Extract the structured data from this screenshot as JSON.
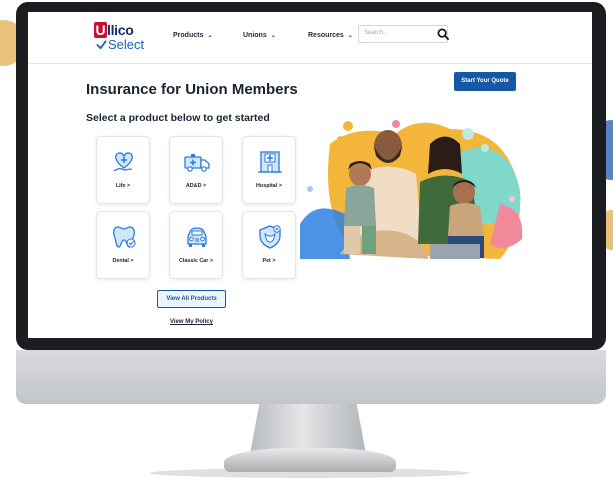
{
  "brand": {
    "logo_mark": "U",
    "logo_top": "llico",
    "logo_bottom": "Select"
  },
  "nav": {
    "items": [
      {
        "label": "Products",
        "icon": "chevron-down-icon"
      },
      {
        "label": "Unions",
        "icon": "chevron-down-icon"
      },
      {
        "label": "Resources",
        "icon": "chevron-down-icon"
      }
    ],
    "search_placeholder": "Search...",
    "search_icon": "search-icon"
  },
  "main": {
    "title": "Insurance for Union Members",
    "subtitle": "Select a product below to get started",
    "quote_button": "Start Your Quote",
    "products": [
      {
        "label": "Life >",
        "icon": "heart-hand-icon"
      },
      {
        "label": "AD&D >",
        "icon": "ambulance-icon"
      },
      {
        "label": "Hospital >",
        "icon": "hospital-icon"
      },
      {
        "label": "Dental >",
        "icon": "tooth-icon"
      },
      {
        "label": "Classic Car >",
        "icon": "classic-car-icon"
      },
      {
        "label": "Pet >",
        "icon": "pet-shield-icon"
      }
    ],
    "view_all_button": "View All Products",
    "policy_link": "View My Policy"
  },
  "colors": {
    "brand_red": "#c8102e",
    "brand_navy": "#0d2c6c",
    "accent_blue": "#1558a8",
    "icon_blue": "#2b7bd6",
    "icon_fill": "#cfe6fb"
  }
}
